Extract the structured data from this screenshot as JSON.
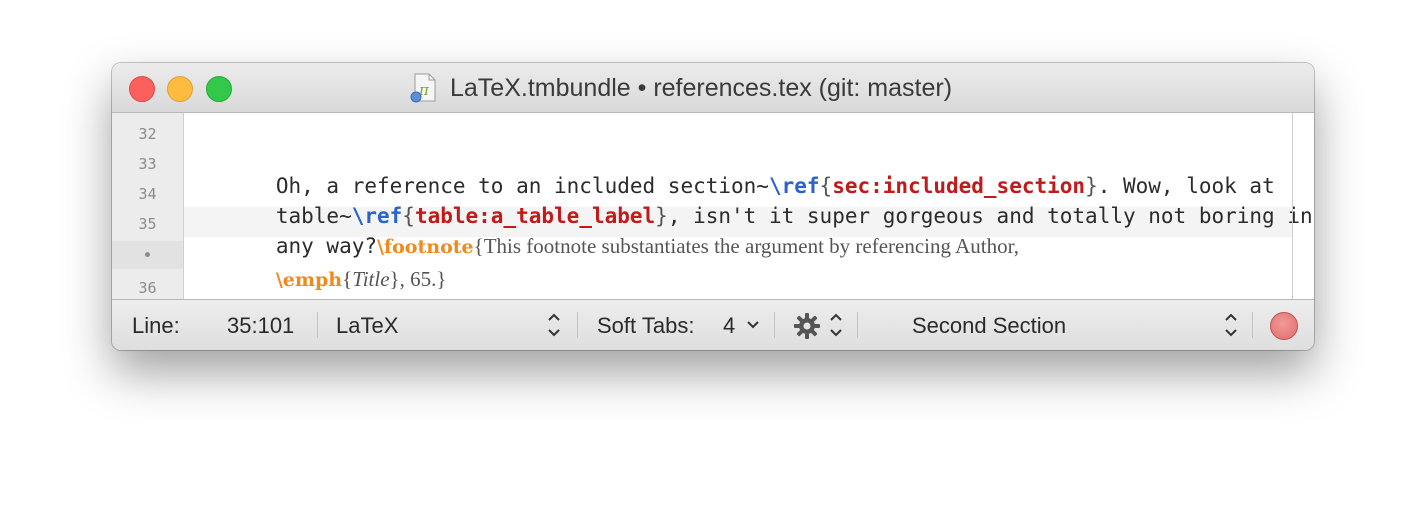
{
  "window": {
    "title": "LaTeX.tmbundle • references.tex (git: master)",
    "traffic_lights": [
      "close",
      "minimize",
      "zoom"
    ],
    "colors": {
      "close": "#fc605c",
      "minimize": "#fdbc40",
      "zoom": "#34c84a"
    }
  },
  "editor": {
    "line_numbers": [
      "32",
      "33",
      "34",
      "35",
      "•",
      "36"
    ],
    "lines": {
      "l33_text": "Oh, a reference to an included section~",
      "l33_cmd": "\\ref",
      "l33_open": "{",
      "l33_label": "sec:included_section",
      "l33_close": "}",
      "l33_tail": ". Wow, look at",
      "l34_text": "table~",
      "l34_cmd": "\\ref",
      "l34_open": "{",
      "l34_label": "table:a_table_label",
      "l34_close": "}",
      "l34_tail": ", isn't it super gorgeous and totally not boring in",
      "l35_text": "any way?",
      "l35_cmd": "\\footnote",
      "l35_open": "{",
      "l35_note": "This footnote substantiates the argument by referencing Author,",
      "wrap_cmd": "\\emph",
      "wrap_open": "{",
      "wrap_title": "Title",
      "wrap_close": "}",
      "wrap_tail": ", 65.}"
    },
    "colors": {
      "command": "#2a63c9",
      "label": "#c21a1a",
      "footnote": "#f08a1c"
    }
  },
  "statusbar": {
    "line_label": "Line:",
    "line_value": "35:101",
    "grammar": "LaTeX",
    "tabs_label": "Soft Tabs:",
    "tabs_value": "4",
    "symbol": "Second Section"
  }
}
